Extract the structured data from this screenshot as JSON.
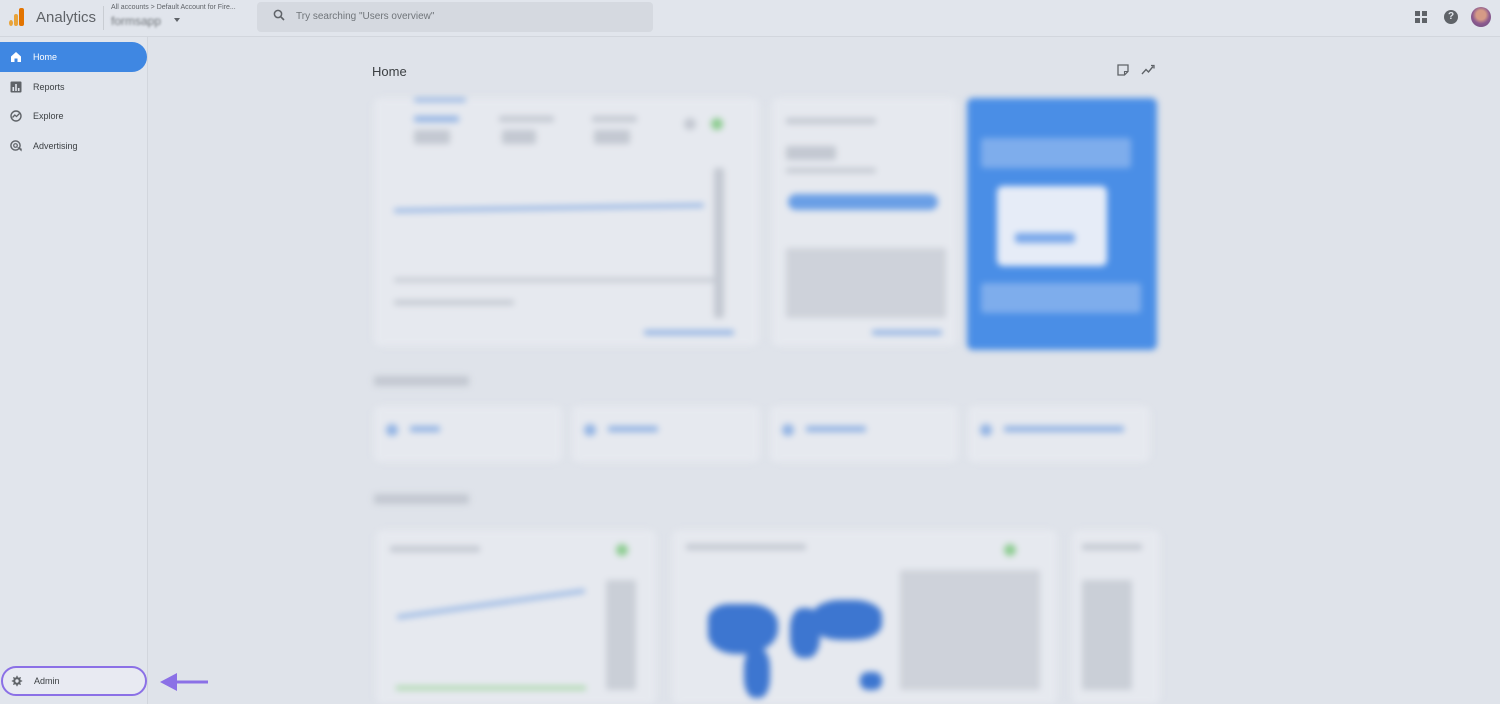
{
  "app": {
    "title": "Analytics",
    "breadcrumb": "All accounts > Default Account for Fire...",
    "property": "formsapp"
  },
  "search": {
    "placeholder": "Try searching \"Users overview\""
  },
  "header_icons": [
    "apps-icon",
    "help-icon",
    "avatar"
  ],
  "sidebar": {
    "items": [
      {
        "label": "Home",
        "icon": "home-icon",
        "active": true
      },
      {
        "label": "Reports",
        "icon": "reports-icon",
        "active": false
      },
      {
        "label": "Explore",
        "icon": "explore-icon",
        "active": false
      },
      {
        "label": "Advertising",
        "icon": "advertising-icon",
        "active": false
      }
    ],
    "admin": {
      "label": "Admin",
      "icon": "gear-icon"
    }
  },
  "main": {
    "title": "Home"
  },
  "colors": {
    "accent": "#3f87e2",
    "highlight": "#8b70e6",
    "analytics_orange": "#e37400"
  }
}
